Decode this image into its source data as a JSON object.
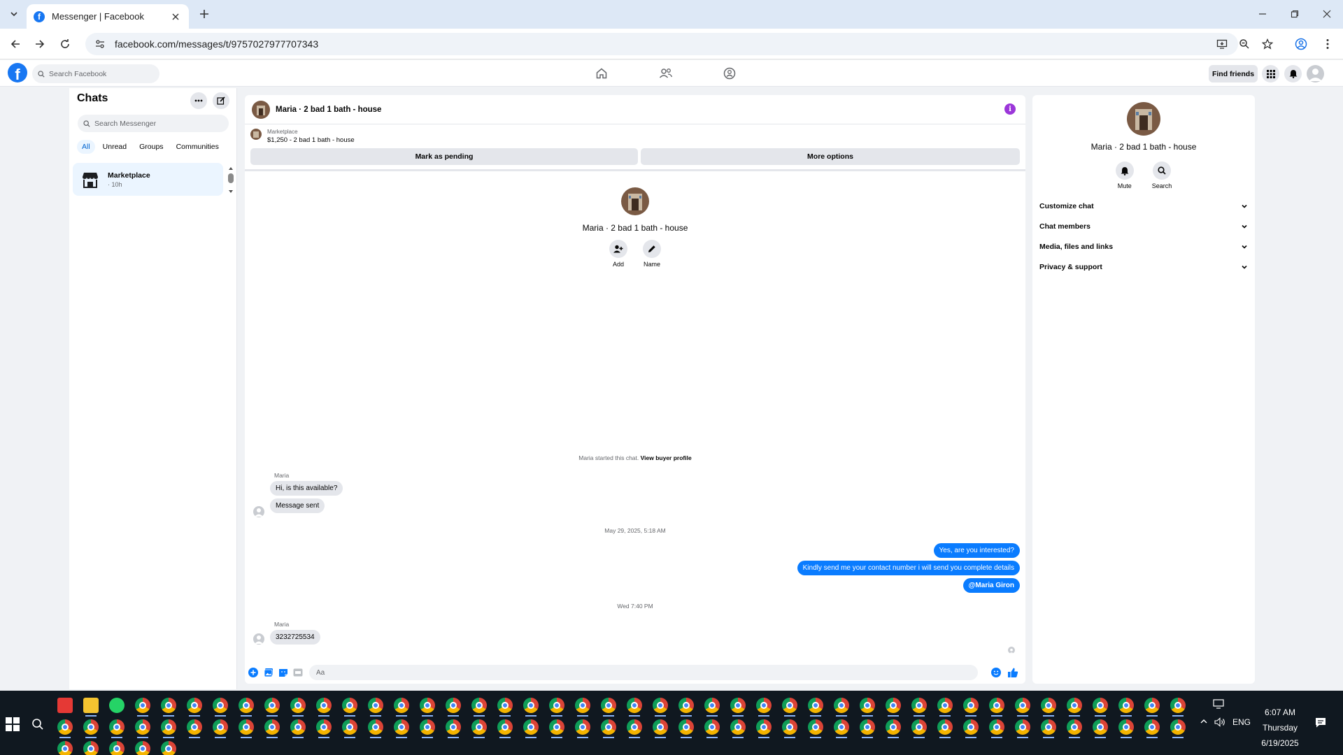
{
  "browser": {
    "tab_title": "Messenger | Facebook",
    "url": "facebook.com/messages/t/9757027977707343"
  },
  "fb_header": {
    "search_placeholder": "Search Facebook",
    "find_friends": "Find friends"
  },
  "sidebar": {
    "title": "Chats",
    "search_placeholder": "Search Messenger",
    "filters": [
      "All",
      "Unread",
      "Groups",
      "Communities"
    ],
    "chat": {
      "name": "Marketplace",
      "time": "· 10h"
    }
  },
  "conversation": {
    "title": "Maria · 2 bad 1 bath - house",
    "listing_category": "Marketplace",
    "listing_desc": "$1,250 - 2 bad 1 bath - house",
    "mark_pending": "Mark as pending",
    "more_options": "More options",
    "intro_name": "Maria · 2 bad 1 bath - house",
    "add_label": "Add",
    "name_label": "Name",
    "started_text": "Maria started this chat.",
    "view_buyer": "View buyer profile",
    "messages": {
      "sender1": "Maria",
      "in1": "Hi, is this available?",
      "in2": "Message sent",
      "stamp1": "May 29, 2025, 5:18 AM",
      "out1": "Yes, are you interested?",
      "out2": "Kindly send me your contact number i will send you complete details",
      "out3": "@Maria Giron",
      "stamp2": "Wed 7:40 PM",
      "sender2": "Maria",
      "in3": "3232725534"
    },
    "composer_placeholder": "Aa"
  },
  "info_panel": {
    "name": "Maria · 2 bad 1 bath - house",
    "mute": "Mute",
    "search": "Search",
    "sections": [
      "Customize chat",
      "Chat members",
      "Media, files and links",
      "Privacy & support"
    ]
  },
  "taskbar": {
    "lang": "ENG",
    "time": "6:07 AM",
    "day": "Thursday",
    "date": "6/19/2025"
  },
  "colors": {
    "facebook_blue": "#1877f2",
    "outgoing_bubble": "#0a7cff",
    "info_icon": "#9b36d9"
  }
}
